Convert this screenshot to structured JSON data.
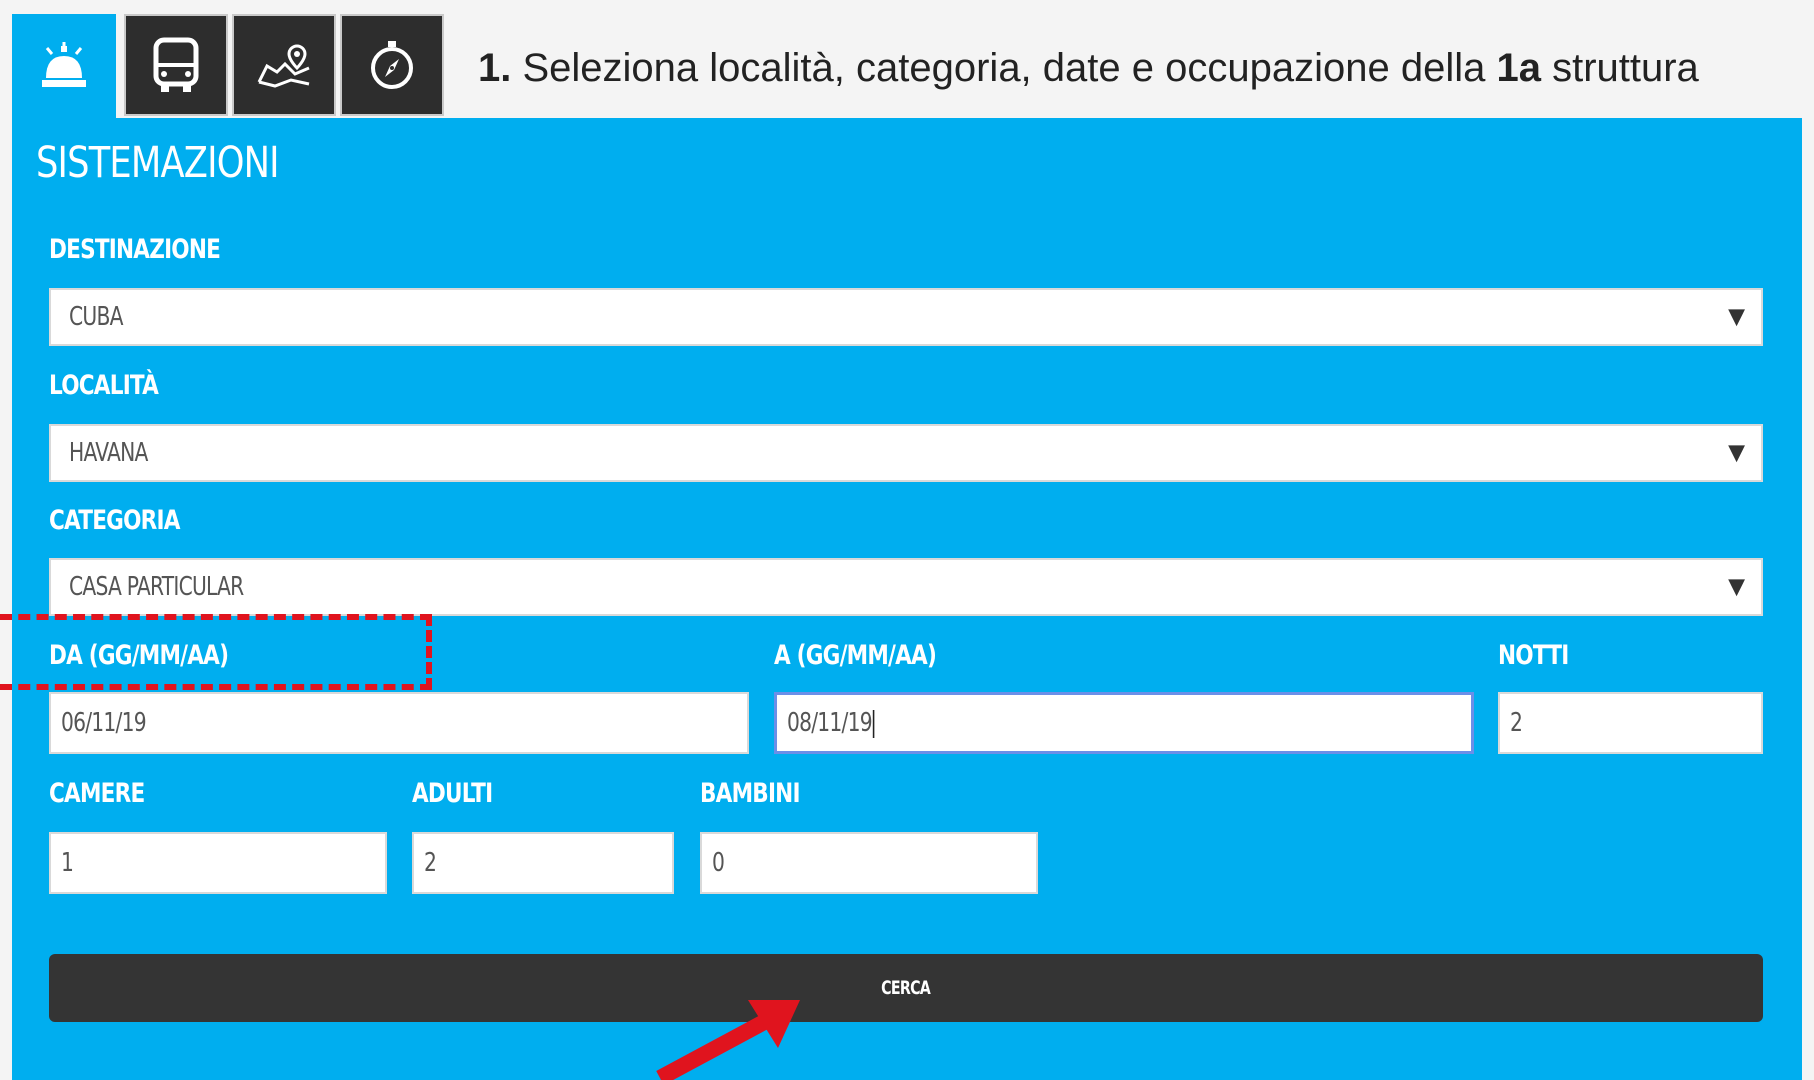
{
  "tabs": [
    {
      "name": "tab-accommodation",
      "icon": "hotel-bell-icon",
      "active": true
    },
    {
      "name": "tab-transfer",
      "icon": "bus-icon",
      "active": false
    },
    {
      "name": "tab-tours",
      "icon": "map-pin-icon",
      "active": false
    },
    {
      "name": "tab-excursions",
      "icon": "compass-icon",
      "active": false
    }
  ],
  "instruction": {
    "step": "1.",
    "text_before": " Seleziona località, categoria, date e occupazione della ",
    "bold": "1a",
    "text_after": " struttura"
  },
  "panel": {
    "title": "SISTEMAZIONI"
  },
  "form": {
    "destinazione": {
      "label": "DESTINAZIONE",
      "value": "CUBA"
    },
    "localita": {
      "label": "LOCALITÀ",
      "value": "HAVANA"
    },
    "categoria": {
      "label": "CATEGORIA",
      "value": "CASA PARTICULAR"
    },
    "da": {
      "label": "DA (GG/MM/AA)",
      "value": "06/11/19"
    },
    "a": {
      "label": "A (GG/MM/AA)",
      "value": "08/11/19"
    },
    "notti": {
      "label": "NOTTI",
      "value": "2"
    },
    "camere": {
      "label": "CAMERE",
      "value": "1"
    },
    "adulti": {
      "label": "ADULTI",
      "value": "2"
    },
    "bambini": {
      "label": "BAMBINI",
      "value": "0"
    },
    "search_label": "CERCA"
  },
  "colors": {
    "panel": "#00aeef",
    "tab_dark": "#2d2d2d",
    "button": "#343434",
    "annotation": "#e0141e"
  }
}
